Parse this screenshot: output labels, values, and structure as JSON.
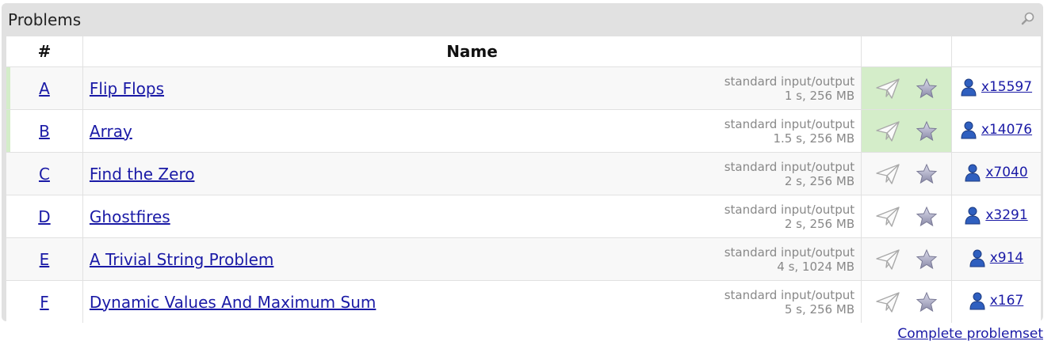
{
  "panel": {
    "title": "Problems"
  },
  "table": {
    "headers": {
      "index": "#",
      "name": "Name"
    },
    "rows": [
      {
        "index": "A",
        "name": "Flip Flops",
        "io": "standard input/output",
        "limits": "1 s, 256 MB",
        "solvers": "x15597",
        "accepted": true
      },
      {
        "index": "B",
        "name": "Array",
        "io": "standard input/output",
        "limits": "1.5 s, 256 MB",
        "solvers": "x14076",
        "accepted": true
      },
      {
        "index": "C",
        "name": "Find the Zero",
        "io": "standard input/output",
        "limits": "2 s, 256 MB",
        "solvers": "x7040",
        "accepted": false
      },
      {
        "index": "D",
        "name": "Ghostfires",
        "io": "standard input/output",
        "limits": "2 s, 256 MB",
        "solvers": "x3291",
        "accepted": false
      },
      {
        "index": "E",
        "name": "A Trivial String Problem",
        "io": "standard input/output",
        "limits": "4 s, 1024 MB",
        "solvers": "x914",
        "accepted": false
      },
      {
        "index": "F",
        "name": "Dynamic Values And Maximum Sum",
        "io": "standard input/output",
        "limits": "5 s, 256 MB",
        "solvers": "x167",
        "accepted": false
      }
    ]
  },
  "footer": {
    "complete_link": "Complete problemset"
  },
  "colors": {
    "accepted": "#d4edc9",
    "link": "#1a1aa6",
    "muted": "#888888"
  },
  "icons": {
    "search": "search-icon",
    "submit": "send-icon",
    "favourite": "star-icon",
    "solvers": "user-icon"
  }
}
